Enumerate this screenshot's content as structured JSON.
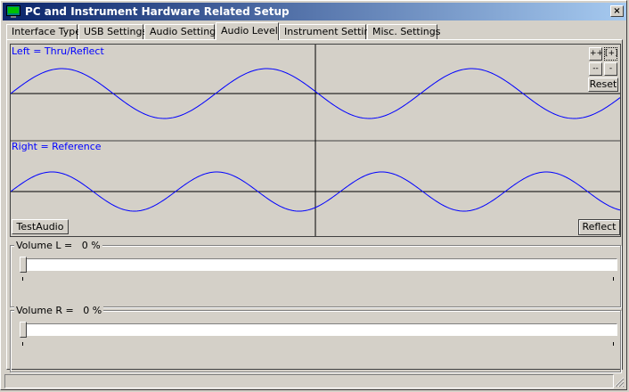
{
  "window": {
    "title": "PC and Instrument Hardware Related Setup",
    "close_label": "×"
  },
  "tabs": [
    {
      "label": "Interface Type",
      "active": false
    },
    {
      "label": "USB Settings",
      "active": false
    },
    {
      "label": "Audio Settings",
      "active": false
    },
    {
      "label": "Audio Level",
      "active": true
    },
    {
      "label": "Instrument Settings",
      "active": false
    },
    {
      "label": "Misc. Settings",
      "active": false
    }
  ],
  "scope": {
    "left_label": "Left = Thru/Reflect",
    "right_label": "Right = Reference",
    "zoom_in_label": "++",
    "zoom_fit_label": "[+]",
    "zoom_out_label": "--",
    "minus_label": "-",
    "reset_label": "Reset",
    "test_audio_label": "TestAudio",
    "reflect_label": "Reflect",
    "trace_color": "#0000ff"
  },
  "volume_left": {
    "label": "Volume L =",
    "value_text": "0 %",
    "value": 0
  },
  "volume_right": {
    "label": "Volume R =",
    "value_text": "0 %",
    "value": 0
  }
}
